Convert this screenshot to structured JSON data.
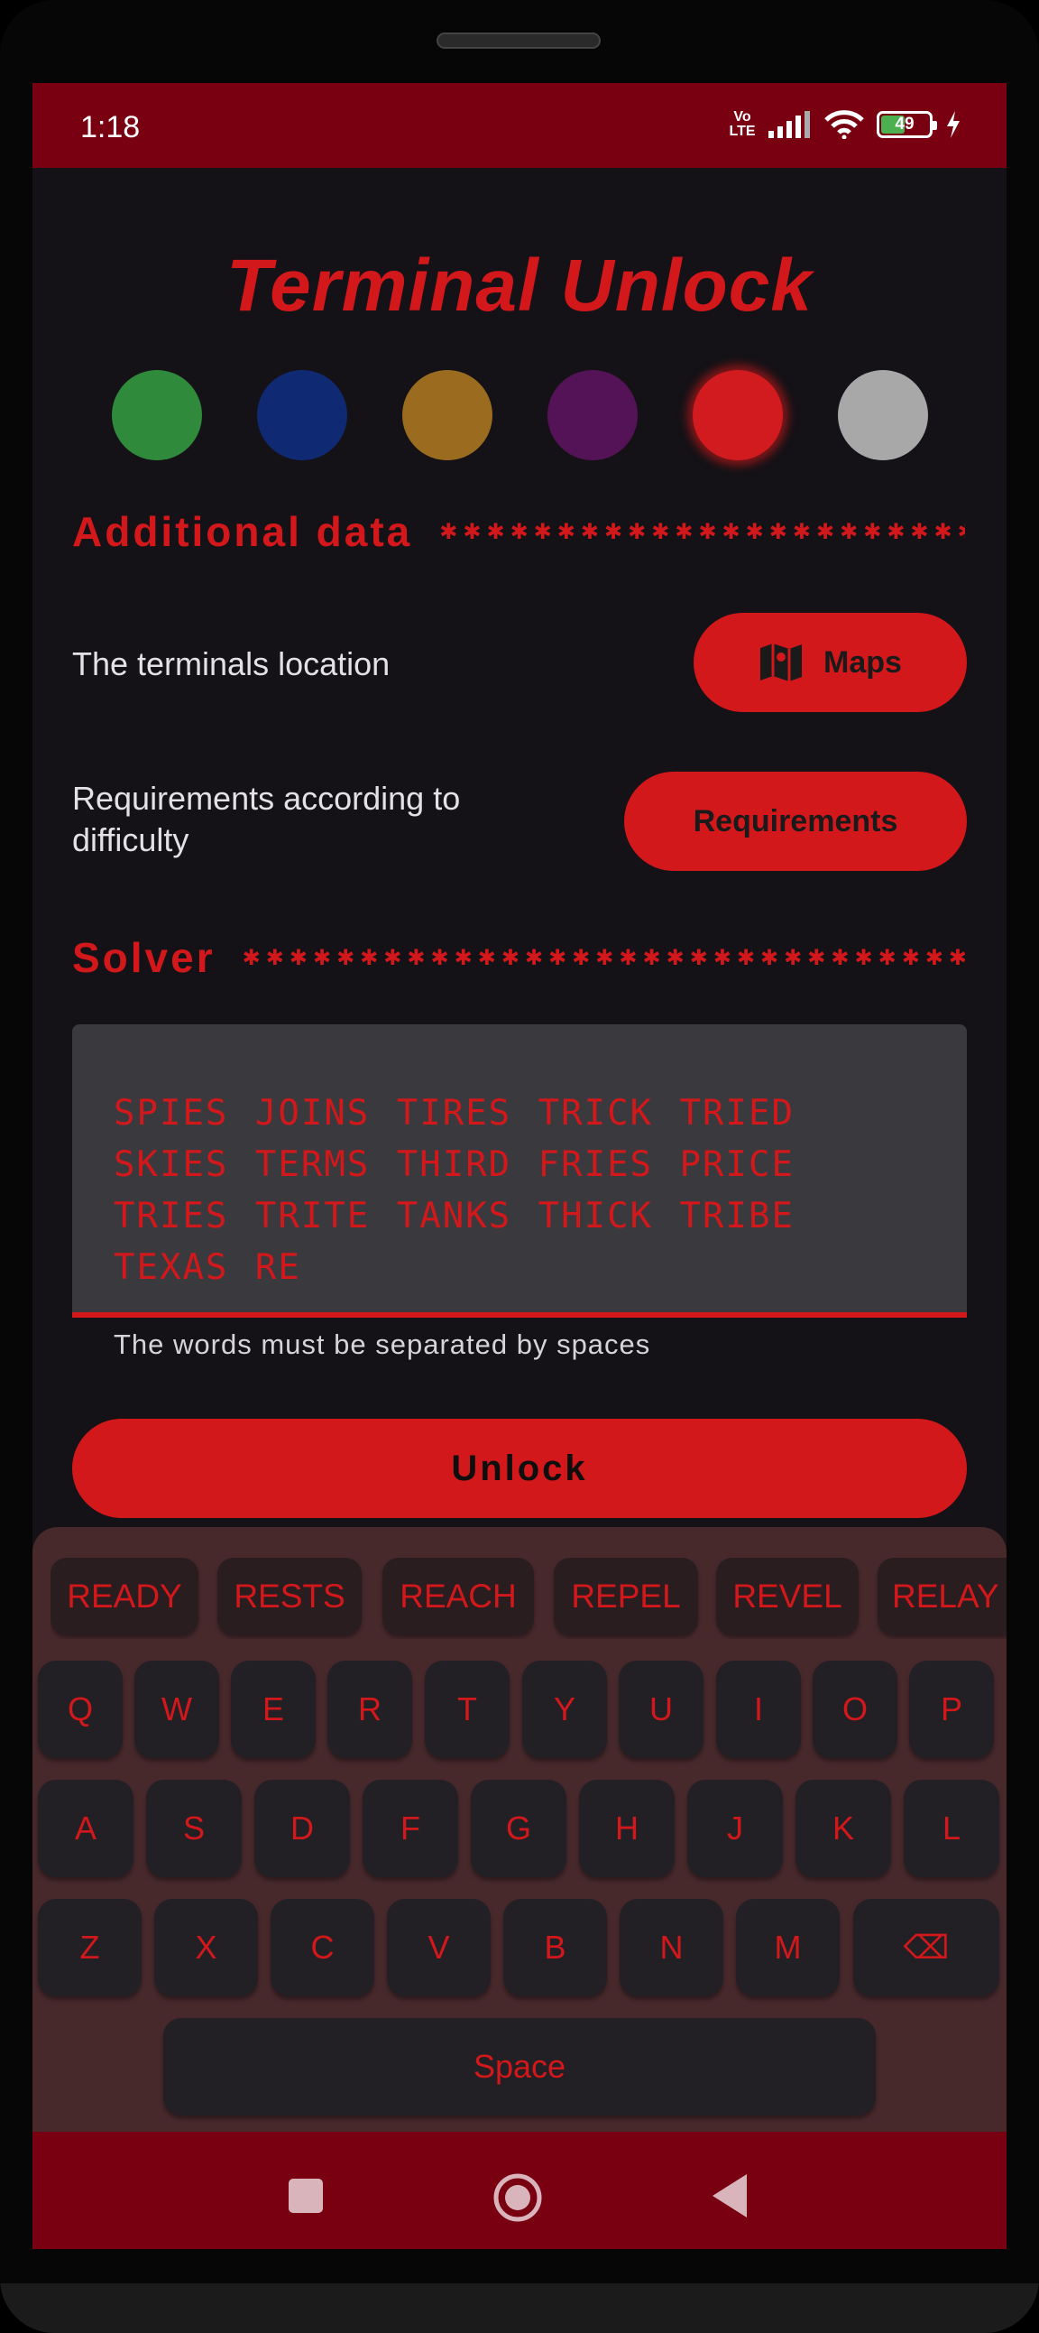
{
  "status_bar": {
    "time": "1:18",
    "network": "VoLTE",
    "battery": "49"
  },
  "app": {
    "title": "Terminal Unlock"
  },
  "color_dots": [
    {
      "name": "green",
      "color": "#2f8a3c"
    },
    {
      "name": "navy",
      "color": "#0f2a73"
    },
    {
      "name": "amber",
      "color": "#9b6b1f"
    },
    {
      "name": "purple",
      "color": "#541357"
    },
    {
      "name": "red",
      "color": "#d21b1f",
      "selected": true
    },
    {
      "name": "gray",
      "color": "#a8a8a8"
    }
  ],
  "additional": {
    "title": "Additional data",
    "location_label": "The terminals location",
    "maps_label": "Maps",
    "req_label_1": "Requirements according to",
    "req_label_2": "difficulty",
    "req_button": "Requirements"
  },
  "solver": {
    "title": "Solver",
    "input_value": "SPIES JOINS TIRES TRICK TRIED SKIES TERMS THIRD FRIES PRICE TRIES TRITE TANKS THICK TRIBE TEXAS RE",
    "helper": "The words must be separated by spaces",
    "unlock_label": "Unlock"
  },
  "keyboard": {
    "suggestions": [
      "READY",
      "RESTS",
      "REACH",
      "REPEL",
      "REVEL",
      "RELAY"
    ],
    "row1": [
      "Q",
      "W",
      "E",
      "R",
      "T",
      "Y",
      "U",
      "I",
      "O",
      "P"
    ],
    "row2": [
      "A",
      "S",
      "D",
      "F",
      "G",
      "H",
      "J",
      "K",
      "L"
    ],
    "row3": [
      "Z",
      "X",
      "C",
      "V",
      "B",
      "N",
      "M"
    ],
    "backspace": "⌫",
    "space": "Space"
  },
  "colors": {
    "accent": "#d3181b",
    "status_bar": "#780010",
    "background": "#141217",
    "keyboard": "#47292c"
  }
}
